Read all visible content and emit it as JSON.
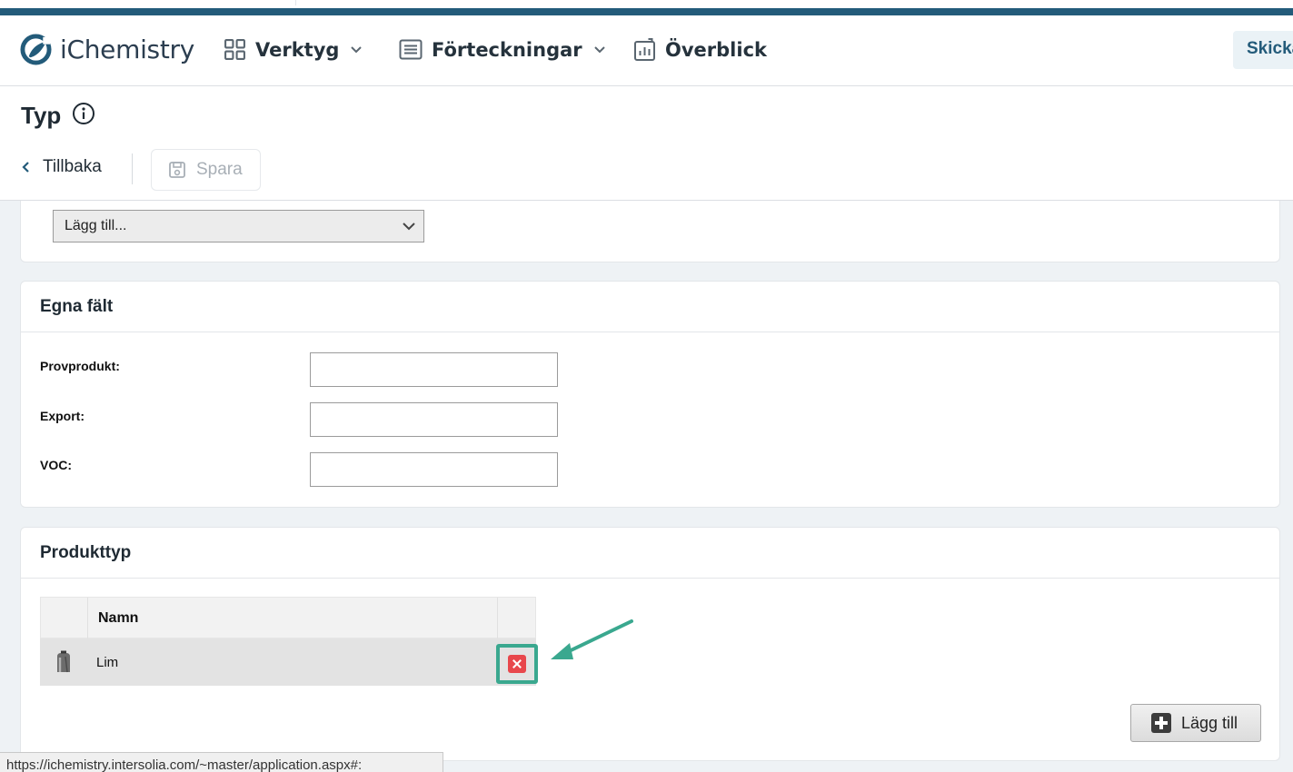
{
  "header": {
    "logo_text": "iChemistry",
    "nav": [
      {
        "label": "Verktyg"
      },
      {
        "label": "Förteckningar"
      },
      {
        "label": "Överblick"
      }
    ],
    "send_label": "Skicka"
  },
  "page": {
    "title": "Typ",
    "back_label": "Tillbaka",
    "save_label": "Spara"
  },
  "add_select": {
    "value": "Lägg till..."
  },
  "egna_falt": {
    "title": "Egna fält",
    "fields": [
      {
        "label": "Provprodukt:",
        "value": ""
      },
      {
        "label": "Export:",
        "value": ""
      },
      {
        "label": "VOC:",
        "value": ""
      }
    ]
  },
  "produkttyp": {
    "title": "Produkttyp",
    "column_name": "Namn",
    "rows": [
      {
        "name": "Lim"
      }
    ],
    "add_label": "Lägg till"
  },
  "status_url": "https://ichemistry.intersolia.com/~master/application.aspx#:",
  "colors": {
    "brand": "#235b7a",
    "highlight": "#3aa88f",
    "delete": "#e8474c"
  }
}
